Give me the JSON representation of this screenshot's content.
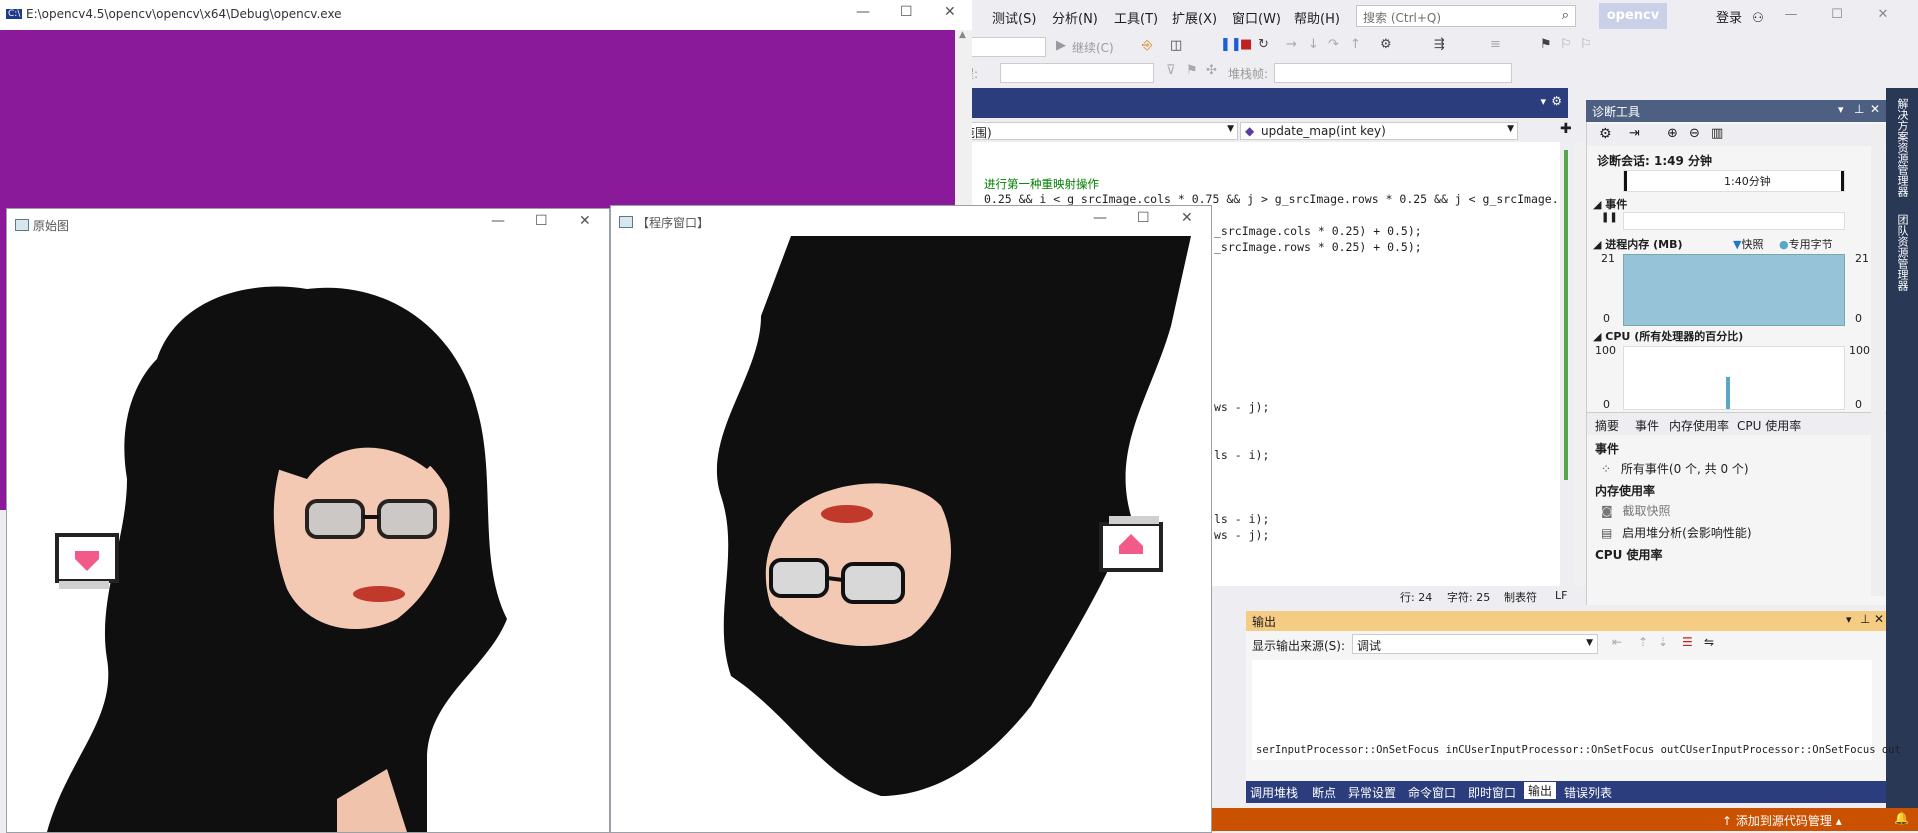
{
  "console": {
    "title": "E:\\opencv4.5\\opencv\\opencv\\x64\\Debug\\opencv.exe",
    "bg_color": "#8b1a9a"
  },
  "window_controls": {
    "minimize": "—",
    "maximize": "☐",
    "close": "✕"
  },
  "original_window": {
    "title": "原始图"
  },
  "program_window": {
    "title": "【程序窗口】"
  },
  "vs": {
    "menu": [
      "测试(S)",
      "分析(N)",
      "工具(T)",
      "扩展(X)",
      "窗口(W)",
      "帮助(H)"
    ],
    "search_placeholder": "搜索 (Ctrl+Q)",
    "project_badge": "opencv",
    "login": "登录",
    "continue_label": "继续(C)",
    "process_label": "程:",
    "stack_frame_label": "堆栈帧:",
    "nav_scope": "范围)",
    "nav_function": "update_map(int key)",
    "code_lines": [
      {
        "text": "进行第一种重映射操作",
        "comment": true
      },
      {
        "text": "0.25 && i < g_srcImage.cols * 0.75 && j > g_srcImage.rows * 0.25 && j < g_srcImage.",
        "comment": false
      },
      {
        "text": "_srcImage.cols * 0.25) + 0.5);",
        "comment": false
      },
      {
        "text": "_srcImage.rows * 0.25) + 0.5);",
        "comment": false
      },
      {
        "text": "ws - j);",
        "comment": false
      },
      {
        "text": "ls - i);",
        "comment": false
      },
      {
        "text": "ls - i);",
        "comment": false
      },
      {
        "text": "ws - j);",
        "comment": false
      }
    ],
    "status_line": "行: 24",
    "status_char": "字符: 25",
    "status_tab": "制表符",
    "status_eol": "LF",
    "add_to_source_control": "添加到源代码管理"
  },
  "diag": {
    "title": "诊断工具",
    "session": "诊断会话: 1:49 分钟",
    "timeline_label": "1:40分钟",
    "events_header": "事件",
    "memory_header": "进程内存 (MB)",
    "snapshot_legend": "快照",
    "private_bytes_legend": "专用字节",
    "mem_max": "21",
    "mem_min": "0",
    "cpu_header": "CPU (所有处理器的百分比)",
    "cpu_max": "100",
    "cpu_min": "0",
    "tabs": [
      "摘要",
      "事件",
      "内存使用率",
      "CPU 使用率"
    ],
    "summary_events_header": "事件",
    "all_events": "所有事件(0 个, 共 0 个)",
    "memory_usage_header": "内存使用率",
    "take_snapshot": "截取快照",
    "heap_analysis": "启用堆分析(会影响性能)",
    "cpu_usage_header": "CPU 使用率",
    "rail_labels": [
      "解决方案资源管理器",
      "团队资源管理器"
    ]
  },
  "output": {
    "title": "输出",
    "source_label": "显示输出来源(S):",
    "source_value": "调试",
    "text": "serInputProcessor::OnSetFocus inCUserInputProcessor::OnSetFocus outCUserInputProcessor::OnSetFocus out",
    "bottom_tabs": [
      "调用堆栈",
      "断点",
      "异常设置",
      "命令窗口",
      "即时窗口",
      "输出",
      "错误列表"
    ]
  }
}
